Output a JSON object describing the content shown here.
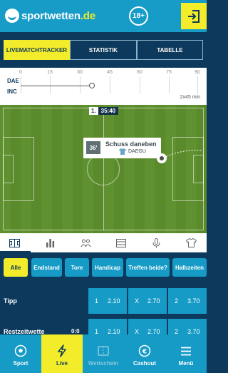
{
  "header": {
    "brand_main": "sportwetten",
    "brand_suffix": ".de",
    "age_badge": "18+",
    "login_icon": "login-icon"
  },
  "tabs": [
    {
      "label": "LIVEMATCHTRACKER",
      "active": true
    },
    {
      "label": "STATISTIK",
      "active": false
    },
    {
      "label": "TABELLE",
      "active": false
    }
  ],
  "timeline": {
    "teams": [
      "DAE",
      "INC"
    ],
    "ticks": [
      "0",
      "15",
      "30",
      "45",
      "60",
      "75",
      "90"
    ],
    "duration": "2x45 min",
    "current_minute": 36
  },
  "pitch": {
    "clock_half": "1.",
    "clock_time": "35:40",
    "event": {
      "minute": "36'",
      "title": "Schuss daneben",
      "team": "DAEGU"
    }
  },
  "stat_icons": [
    "pitch-icon",
    "bar-chart-icon",
    "lineup-icon",
    "table-icon",
    "microphone-icon",
    "shirt-icon"
  ],
  "filters": [
    {
      "label": "Alle",
      "active": true
    },
    {
      "label": "Endstand",
      "active": false
    },
    {
      "label": "Tore",
      "active": false
    },
    {
      "label": "Handicap",
      "active": false
    },
    {
      "label": "Treffen beide?",
      "active": false
    },
    {
      "label": "Halbzeiten",
      "active": false
    }
  ],
  "markets": [
    {
      "name": "Tipp",
      "score": "",
      "odds": [
        {
          "label": "1",
          "value": "2.10"
        },
        {
          "label": "X",
          "value": "2.70"
        },
        {
          "label": "2",
          "value": "3.70"
        }
      ]
    },
    {
      "name": "Restzeitwette",
      "score": "0:0",
      "odds": [
        {
          "label": "1",
          "value": "2.10"
        },
        {
          "label": "X",
          "value": "2.70"
        },
        {
          "label": "2",
          "value": "3.70"
        }
      ]
    }
  ],
  "bottom_nav": [
    {
      "label": "Sport",
      "icon": "soccer-ball-icon",
      "state": "normal"
    },
    {
      "label": "Live",
      "icon": "lightning-icon",
      "state": "active"
    },
    {
      "label": "Wettschein",
      "icon": "betslip-icon",
      "state": "disabled"
    },
    {
      "label": "Cashout",
      "icon": "euro-icon",
      "state": "normal"
    },
    {
      "label": "Menü",
      "icon": "hamburger-menu-icon",
      "state": "normal"
    }
  ],
  "colors": {
    "brand_blue": "#169cc7",
    "navy": "#0d3a5c",
    "accent_yellow": "#f2ec2a",
    "pitch_green": "#5a8a2b"
  }
}
